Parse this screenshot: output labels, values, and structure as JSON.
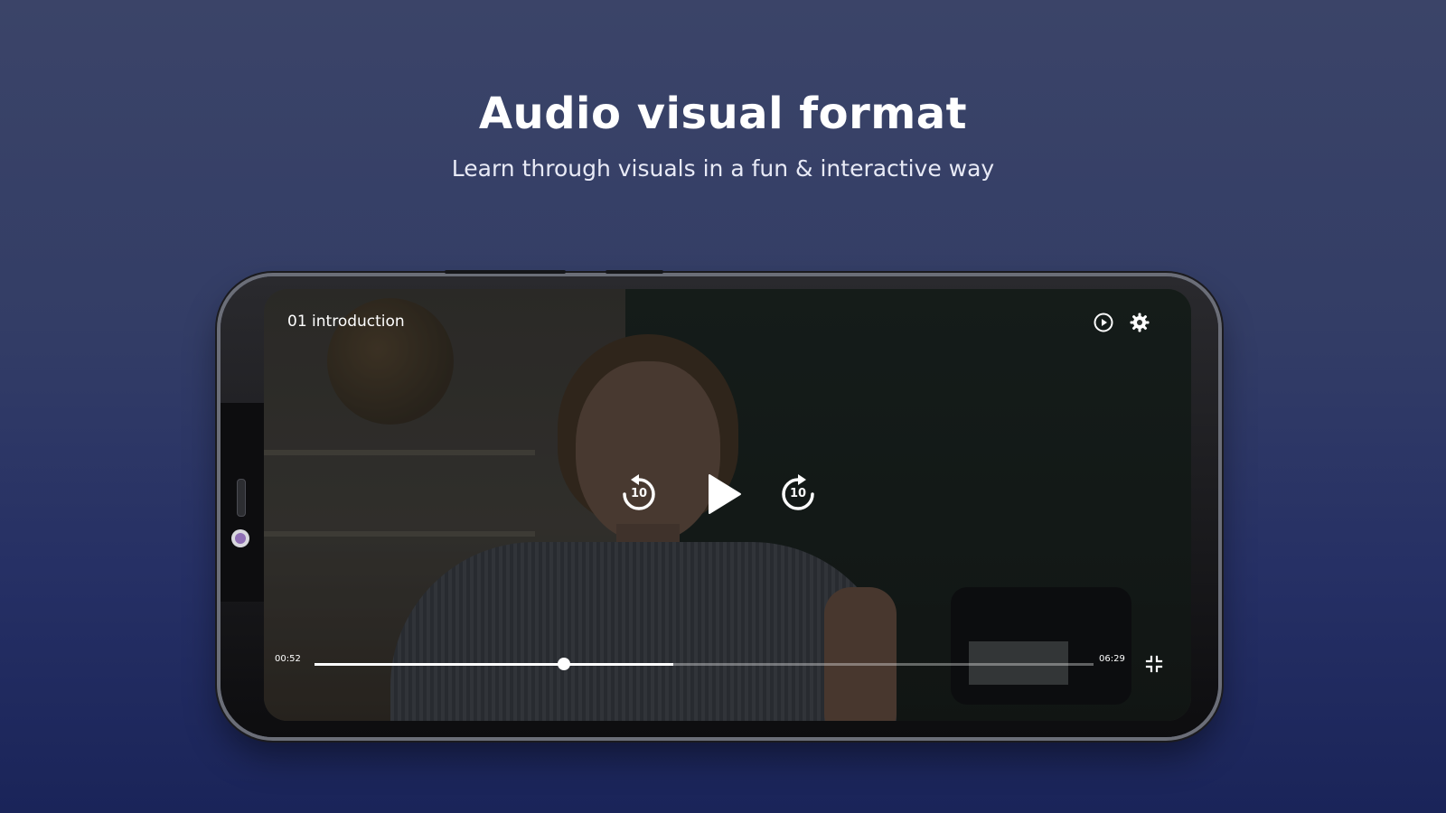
{
  "header": {
    "title": "Audio visual format",
    "subtitle": "Learn through visuals in a fun & interactive way"
  },
  "player": {
    "video_title": "01 introduction",
    "current_time": "00:52",
    "total_time": "06:29",
    "progress_fraction": 0.32,
    "buffered_fraction": 0.46,
    "rewind_seconds": "10",
    "forward_seconds": "10",
    "icons": {
      "speed": "play-circle-icon",
      "settings": "gear-icon",
      "rewind": "rewind-10-icon",
      "play": "play-icon",
      "forward": "forward-10-icon",
      "fullscreen": "exit-fullscreen-icon"
    }
  },
  "colors": {
    "background_top": "#3b4468",
    "background_bottom": "#1a2459",
    "text_primary": "#ffffff",
    "camera_accent": "#8f6fb5"
  }
}
